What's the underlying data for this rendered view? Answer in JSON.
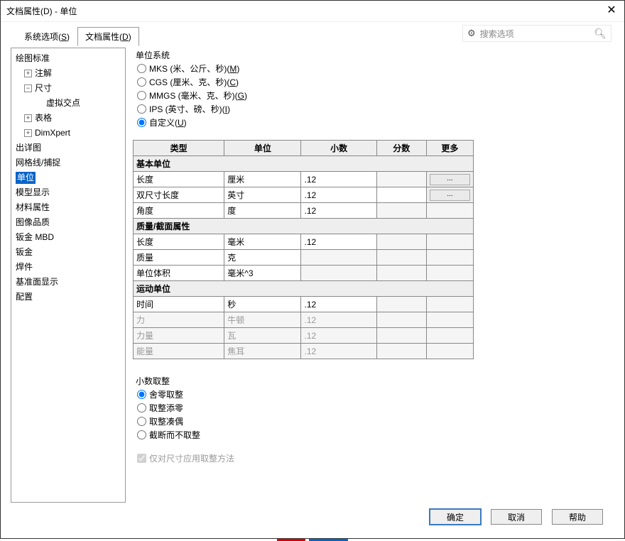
{
  "window": {
    "title": "文档属性(D) - 单位"
  },
  "tabs": {
    "system": "系统选项(",
    "system_u": "S",
    "system_end": ")",
    "doc": "文档属性(",
    "doc_u": "D",
    "doc_end": ")"
  },
  "search": {
    "placeholder": "搜索选项"
  },
  "tree": {
    "root0": "绘图标准",
    "c0": "注解",
    "c1": "尺寸",
    "c1a": "虚拟交点",
    "c2": "表格",
    "c3": "DimXpert",
    "n1": "出详图",
    "n2": "网格线/捕捉",
    "n3": "单位",
    "n4": "模型显示",
    "n5": "材料属性",
    "n6": "图像品质",
    "n7": "钣金 MBD",
    "n8": "钣金",
    "n9": "焊件",
    "n10": "基准面显示",
    "n11": "配置"
  },
  "unit_system": {
    "title": "单位系统",
    "mks": "MKS (米、公斤、秒)(",
    "mks_u": "M",
    "mks_end": ")",
    "cgs": "CGS (厘米、克、秒)(",
    "cgs_u": "C",
    "cgs_end": ")",
    "mmgs": "MMGS (毫米、克、秒)(",
    "mmgs_u": "G",
    "mmgs_end": ")",
    "ips": "IPS (英寸、磅、秒)(",
    "ips_u": "I",
    "ips_end": ")",
    "custom": "自定义(",
    "custom_u": "U",
    "custom_end": ")"
  },
  "table": {
    "h_type": "类型",
    "h_unit": "单位",
    "h_dec": "小数",
    "h_frac": "分数",
    "h_more": "更多",
    "sec_basic": "基本单位",
    "r1_type": "长度",
    "r1_unit": "厘米",
    "r1_dec": ".12",
    "more_btn": "...",
    "r2_type": "双尺寸长度",
    "r2_unit": "英寸",
    "r2_dec": ".12",
    "r3_type": "角度",
    "r3_unit": "度",
    "r3_dec": ".12",
    "sec_mass": "质量/截面属性",
    "r4_type": "长度",
    "r4_unit": "毫米",
    "r4_dec": ".12",
    "r5_type": "质量",
    "r5_unit": "克",
    "r6_type": "单位体积",
    "r6_unit": "毫米^3",
    "sec_motion": "运动单位",
    "r7_type": "时间",
    "r7_unit": "秒",
    "r7_dec": ".12",
    "r8_type": "力",
    "r8_unit": "牛顿",
    "r8_dec": ".12",
    "r9_type": "力量",
    "r9_unit": "瓦",
    "r9_dec": ".12",
    "r10_type": "能量",
    "r10_unit": "焦耳",
    "r10_dec": ".12"
  },
  "rounding": {
    "title": "小数取整",
    "r1": "舍零取整",
    "r2": "取整添零",
    "r3": "取整凑偶",
    "r4": "截断而不取整"
  },
  "check_apply": "仅对尺寸应用取整方法",
  "footer": {
    "ok": "确定",
    "cancel": "取消",
    "help": "帮助"
  }
}
